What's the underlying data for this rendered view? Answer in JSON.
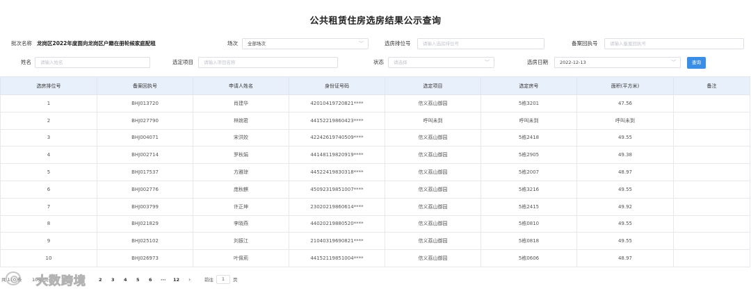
{
  "page": {
    "title": "公共租赁住房选房结果公示查询"
  },
  "filters": {
    "batch_label": "批次名称",
    "batch_value": "龙岗区2022年度面向龙岗区户籍在册轮候家庭配租",
    "round_label": "场次",
    "round_value": "全部场次",
    "queue_label": "选房排位号",
    "queue_placeholder": "请输入选房排位号",
    "record_label": "备案回执号",
    "record_placeholder": "请输入备案回执号",
    "name_label": "姓名",
    "name_placeholder": "请输入姓名",
    "project_label": "选定项目",
    "project_placeholder": "请输入项目名称",
    "status_label": "状态",
    "status_placeholder": "请选择",
    "date_label": "选房日期",
    "date_value": "2022-12-13",
    "query_button": "查询"
  },
  "table": {
    "columns": [
      "选房排位号",
      "备案回执号",
      "申请人姓名",
      "身份证号码",
      "选定项目",
      "选定房号",
      "面积(平方米)",
      "备注"
    ],
    "rows": [
      [
        "1",
        "BHJ013720",
        "肖建华",
        "42010419720821****",
        "信义荔山御园",
        "5栋3201",
        "47.56",
        ""
      ],
      [
        "2",
        "BHJ027790",
        "林婉君",
        "44152219860423****",
        "呼叫未到",
        "呼叫未到",
        "呼叫未到",
        ""
      ],
      [
        "3",
        "BHJ004071",
        "宋洪姣",
        "42242619740509****",
        "信义荔山御园",
        "5栋2418",
        "49.55",
        ""
      ],
      [
        "4",
        "BHJ002714",
        "罗秋娟",
        "44148119820919****",
        "信义荔山御园",
        "5栋2905",
        "49.38",
        ""
      ],
      [
        "5",
        "BHJ017537",
        "方雅琼",
        "44522419830318****",
        "信义荔山御园",
        "5栋2007",
        "48.97",
        ""
      ],
      [
        "6",
        "BHJ002776",
        "庞秋麒",
        "45092319851007****",
        "信义荔山御园",
        "5栋3216",
        "49.55",
        ""
      ],
      [
        "7",
        "BHJ003799",
        "许正坤",
        "23020219860614****",
        "信义荔山御园",
        "5栋2415",
        "49.92",
        ""
      ],
      [
        "8",
        "BHJ021829",
        "李晓燕",
        "44020219880520****",
        "信义荔山御园",
        "5栋0810",
        "49.55",
        ""
      ],
      [
        "9",
        "BHJ025102",
        "刘振江",
        "21040319690821****",
        "信义荔山御园",
        "5栋0818",
        "49.55",
        ""
      ],
      [
        "10",
        "BHJ026973",
        "叶佩莉",
        "44152119851004****",
        "信义荔山御园",
        "5栋0606",
        "48.97",
        ""
      ]
    ]
  },
  "pagination": {
    "total_text": "共 110 条",
    "page_size": "10条/页",
    "pages": [
      "2",
      "3",
      "4",
      "5",
      "6"
    ],
    "ellipsis": "···",
    "last_page": "12",
    "next": "›",
    "goto_label": "前往",
    "goto_value": "1",
    "goto_unit": "页"
  },
  "watermark": {
    "text": "大数跨境"
  }
}
